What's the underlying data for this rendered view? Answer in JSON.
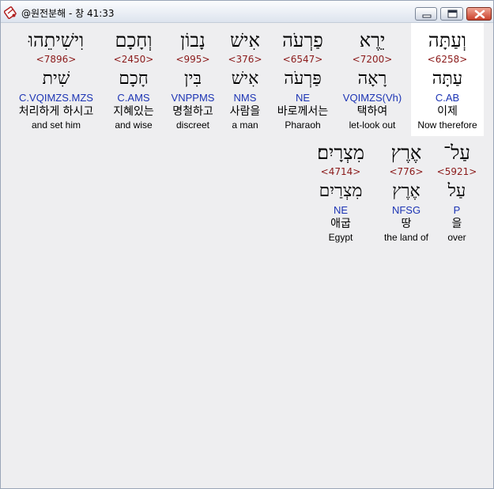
{
  "window": {
    "title": "@원전분해 - 창 41:33"
  },
  "row1": [
    {
      "hebrew": "וְעַתָּה",
      "strong": "<6258>",
      "lemma": "עַתָּה",
      "parse": "C.AB",
      "korean": "이제",
      "english": "Now therefore"
    },
    {
      "hebrew": "יֵרֶא",
      "strong": "<7200>",
      "lemma": "רָאָה",
      "parse": "VQIMZS(Vh)",
      "korean": "택하여",
      "english": "let-look out"
    },
    {
      "hebrew": "פַרְעֹה",
      "strong": "<6547>",
      "lemma": "פַּרְעֹה",
      "parse": "NE",
      "korean": "바로께서는",
      "english": "Pharaoh"
    },
    {
      "hebrew": "אִישׁ",
      "strong": "<376>",
      "lemma": "אִישׁ",
      "parse": "NMS",
      "korean": "사람을",
      "english": "a man"
    },
    {
      "hebrew": "נָבוֹן",
      "strong": "<995>",
      "lemma": "בִּין",
      "parse": "VNPPMS",
      "korean": "명철하고",
      "english": "discreet"
    },
    {
      "hebrew": "וְחָכָם",
      "strong": "<2450>",
      "lemma": "חָכָם",
      "parse": "C.AMS",
      "korean": "지혜있는",
      "english": "and wise"
    },
    {
      "hebrew": "וִישִׁיתֵהוּ",
      "strong": "<7896>",
      "lemma": "שִׁית",
      "parse": "C.VQIMZS.MZS",
      "korean": "처리하게 하시고",
      "english": "and set him"
    }
  ],
  "row2": [
    {
      "hebrew": "עַל־",
      "strong": "<5921>",
      "lemma": "עַל",
      "parse": "P",
      "korean": "을",
      "english": "over"
    },
    {
      "hebrew": "אֶרֶץ",
      "strong": "<776>",
      "lemma": "אֶרֶץ",
      "parse": "NFSG",
      "korean": "땅",
      "english": "the land of"
    },
    {
      "hebrew": "מִצְרָיִם׃",
      "strong": "<4714>",
      "lemma": "מִצְרַיִם",
      "parse": "NE",
      "korean": "애굽",
      "english": "Egypt"
    }
  ],
  "icons": {
    "app": "bible-book-icon",
    "minimize": "minimize-icon",
    "maximize": "maximize-icon",
    "close": "close-icon"
  },
  "colors": {
    "strong": "#8b1a1a",
    "parse": "#1c34b4",
    "highlight": "#ffffff",
    "background": "#eeeef0",
    "close_button": "#c9402a"
  }
}
